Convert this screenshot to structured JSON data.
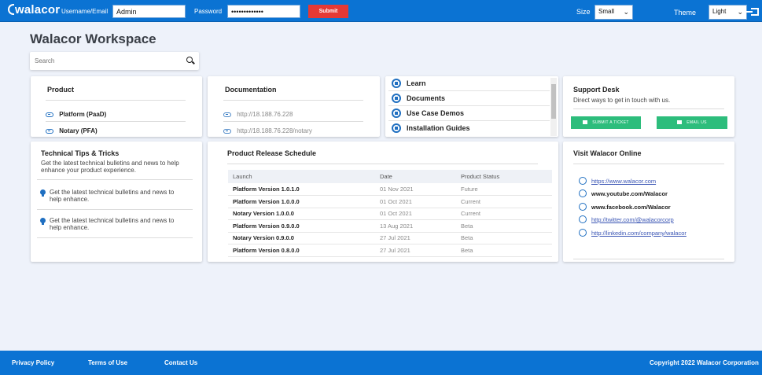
{
  "header": {
    "logo": "walacor",
    "username_label": "Username/Email",
    "username_value": "Admin",
    "password_label": "Password",
    "password_value": "•••••••••••••",
    "submit_label": "Submit",
    "size_label": "Size",
    "size_value": "Small",
    "theme_label": "Theme",
    "theme_value": "Light",
    "logout_icon": "logout-icon"
  },
  "main": {
    "title": "Walacor Workspace",
    "search_placeholder": "Search"
  },
  "product": {
    "title": "Product",
    "items": [
      "Platform (PaaD)",
      "Notary (PFA)"
    ]
  },
  "documentation": {
    "title": "Documentation",
    "items": [
      "http://18.188.76.228",
      "http://18.188.76.228/notary"
    ]
  },
  "learn": {
    "items": [
      "Learn",
      "Documents",
      "Use Case Demos",
      "Installation Guides"
    ]
  },
  "support": {
    "title": "Support Desk",
    "subtitle": "Direct ways to get in touch with us.",
    "ticket_label": "SUBMIT A TICKET",
    "email_label": "EMAIL US"
  },
  "tips": {
    "title": "Technical Tips & Tricks",
    "intro": "Get the latest technical bulletins and news to help enhance your product experience.",
    "items": [
      "Get the latest technical bulletins and news to help enhance.",
      "Get the latest technical bulletins and news to help enhance."
    ]
  },
  "schedule": {
    "title": "Product Release Schedule",
    "columns": [
      "Launch",
      "Date",
      "Product Status"
    ],
    "rows": [
      [
        "Platform Version 1.0.1.0",
        "01 Nov 2021",
        "Future"
      ],
      [
        "Platform Version 1.0.0.0",
        "01 Oct 2021",
        "Current"
      ],
      [
        "Notary Version 1.0.0.0",
        "01 Oct 2021",
        "Current"
      ],
      [
        "Platform Version 0.9.0.0",
        "13 Aug 2021",
        "Beta"
      ],
      [
        "Notary Version 0.9.0.0",
        "27 Jul 2021",
        "Beta"
      ],
      [
        "Platform Version 0.8.0.0",
        "27 Jul 2021",
        "Beta"
      ]
    ]
  },
  "online": {
    "title": "Visit Walacor Online",
    "items": [
      {
        "icon": "globe-icon",
        "text": "https://www.walacor.com",
        "style": "link"
      },
      {
        "icon": "youtube-icon",
        "text": "www.youtube.com/Walacor",
        "style": "bold"
      },
      {
        "icon": "facebook-icon",
        "text": "www.facebook.com/Walacor",
        "style": "bold"
      },
      {
        "icon": "twitter-icon",
        "text": "http://twitter.com/@walacorcorp",
        "style": "link"
      },
      {
        "icon": "linkedin-icon",
        "text": "http://linkedin.com/company/walacor",
        "style": "link"
      }
    ]
  },
  "footer": {
    "privacy": "Privacy Policy",
    "terms": "Terms of Use",
    "contact": "Contact Us",
    "copyright": "Copyright 2022 Walacor Corporation"
  },
  "colors": {
    "brand": "#0b73d3",
    "submit": "#e53935",
    "green": "#2dbd7c"
  }
}
